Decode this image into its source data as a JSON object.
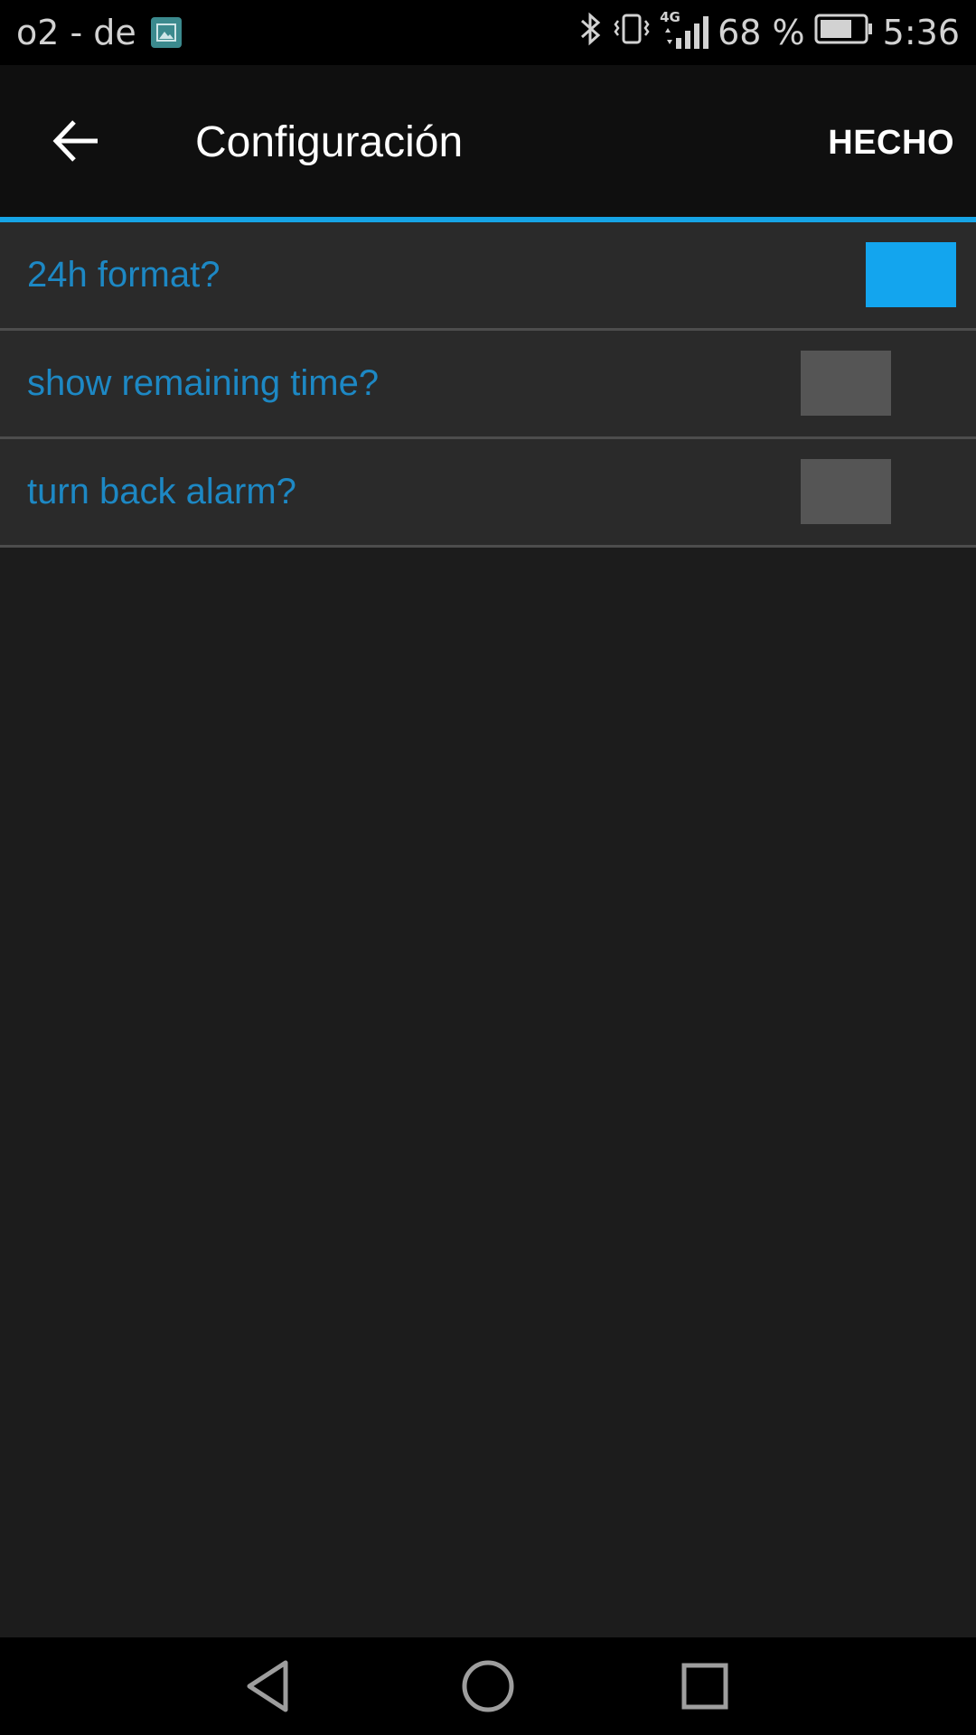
{
  "status_bar": {
    "carrier": "o2 - de",
    "network": "4G",
    "battery": "68 %",
    "time": "5:36",
    "icons": [
      "gallery-notification-icon",
      "bluetooth-icon",
      "vibrate-icon",
      "signal-icon",
      "battery-icon"
    ]
  },
  "app_bar": {
    "title": "Configuración",
    "done_label": "HECHO",
    "back_icon": "arrow-left-icon"
  },
  "settings": [
    {
      "label": "24h format?",
      "checked": true
    },
    {
      "label": "show remaining time?",
      "checked": false
    },
    {
      "label": "turn back alarm?",
      "checked": false
    }
  ],
  "colors": {
    "accent": "#13a5ee",
    "label": "#1d88c4",
    "toggle_off": "#555555",
    "background": "#1c1c1c"
  },
  "nav_bar": {
    "icons": [
      "back-triangle-icon",
      "home-circle-icon",
      "recents-square-icon"
    ]
  }
}
